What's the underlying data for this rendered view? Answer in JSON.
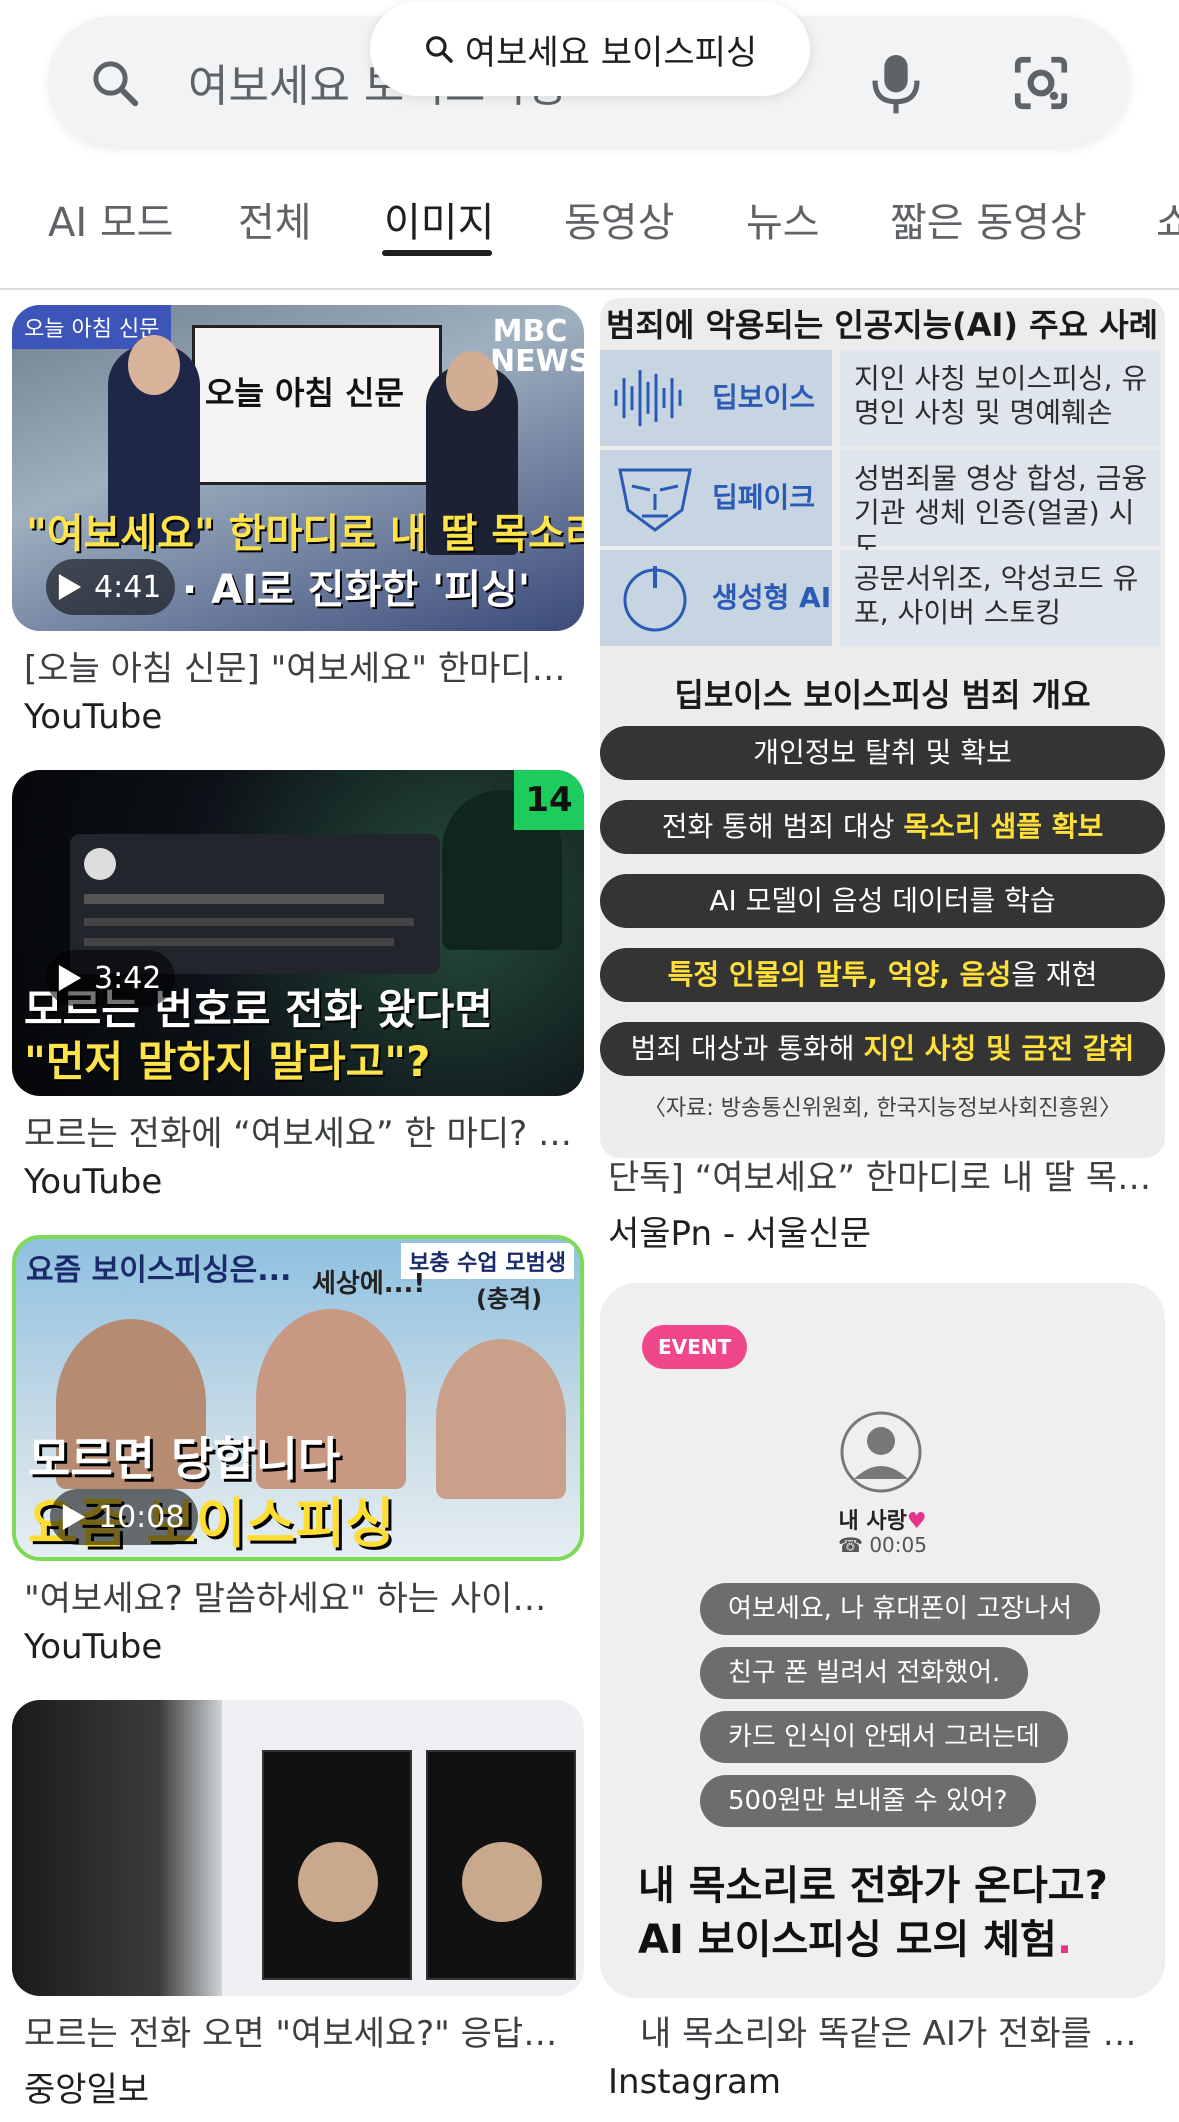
{
  "search": {
    "input_text": "여보세요 보이스피싱",
    "query_pill": "여보세요 보이스피싱"
  },
  "tabs": [
    {
      "label": "AI 모드"
    },
    {
      "label": "전체"
    },
    {
      "label": "이미지",
      "active": true
    },
    {
      "label": "동영상"
    },
    {
      "label": "뉴스"
    },
    {
      "label": "짧은 동영상"
    },
    {
      "label": "쇼"
    }
  ],
  "results_left": [
    {
      "thumb_badge": "오늘 아침 신문",
      "thumb_logo": "MBC NEWS",
      "thumb_board": "오늘 아침 신문",
      "thumb_headline": "\"여보세요\" 한마디로 내 딸 목소리",
      "thumb_sub": "· AI로 진화한 '피싱'",
      "duration": "4:41",
      "caption": "[오늘 아침 신문] \"여보세요\" 한마디…",
      "source": "YouTube"
    },
    {
      "thumb_headline1": "모르는 번호로 전화 왔다면",
      "thumb_headline2": "\"먼저 말하지 말라고\"?",
      "thumb_corner": "14",
      "duration": "3:42",
      "caption": "모르는 전화에 “여보세요” 한 마디? …",
      "source": "YouTube"
    },
    {
      "thumb_top": "요즘 보이스피싱은...",
      "thumb_tag": "보충 수업 모범생",
      "thumb_quote": "세상에...!",
      "thumb_quote2": "(충격)",
      "thumb_h1": "모르면 당합니다",
      "thumb_h2": "요즘 보이스피싱",
      "duration": "10:08",
      "caption": "\"여보세요? 말씀하세요\" 하는 사이…",
      "source": "YouTube"
    },
    {
      "caption": "모르는 전화 오면 \"여보세요?\" 응답…",
      "source": "중앙일보"
    }
  ],
  "results_right": [
    {
      "chart_title": "범죄에 악용되는 인공지능(AI) 주요 사례",
      "rows": [
        {
          "label": "딥보이스",
          "desc": "지인 사칭 보이스피싱, 유명인 사칭 및 명예훼손"
        },
        {
          "label": "딥페이크",
          "desc": "성범죄물 영상 합성, 금융기관 생체 인증(얼굴) 시도"
        },
        {
          "label": "생성형 AI",
          "desc": "공문서위조, 악성코드 유포, 사이버 스토킹"
        }
      ],
      "section_title": "딥보이스 보이스피싱 범죄 개요",
      "steps": [
        {
          "pre": "개인정보 탈취 및 확보",
          "hl": "",
          "post": ""
        },
        {
          "pre": "전화 통해 범죄 대상 ",
          "hl": "목소리 샘플 확보",
          "post": ""
        },
        {
          "pre": "AI 모델이 음성 데이터를 학습",
          "hl": "",
          "post": ""
        },
        {
          "pre": "",
          "hl": "특정 인물의 말투, 억양, 음성",
          "post": "을 재현"
        },
        {
          "pre": "범죄 대상과 통화해 ",
          "hl": "지인 사칭 및 금전 갈취",
          "post": ""
        }
      ],
      "source_note": "〈자료: 방송통신위원회, 한국지능정보사회진흥원〉",
      "caption": "단독] “여보세요” 한마디로 내 딸 목…",
      "source": "서울Pn - 서울신문"
    },
    {
      "event_pill": "EVENT",
      "contact_name": "내 사랑",
      "heart": "♥",
      "call_time": "00:05",
      "bubbles": [
        "여보세요, 나 휴대폰이 고장나서",
        "친구 폰 빌려서 전화했어.",
        "카드 인식이 안돼서 그러는데",
        "500원만 보내줄 수 있어?"
      ],
      "big_line1": "내 목소리로 전화가 온다고?",
      "big_line2": "AI 보이스피싱 모의 체험",
      "big_dot": ".",
      "caption": "내 목소리와 똑같은 AI가 전화를 …",
      "source": "Instagram"
    }
  ]
}
